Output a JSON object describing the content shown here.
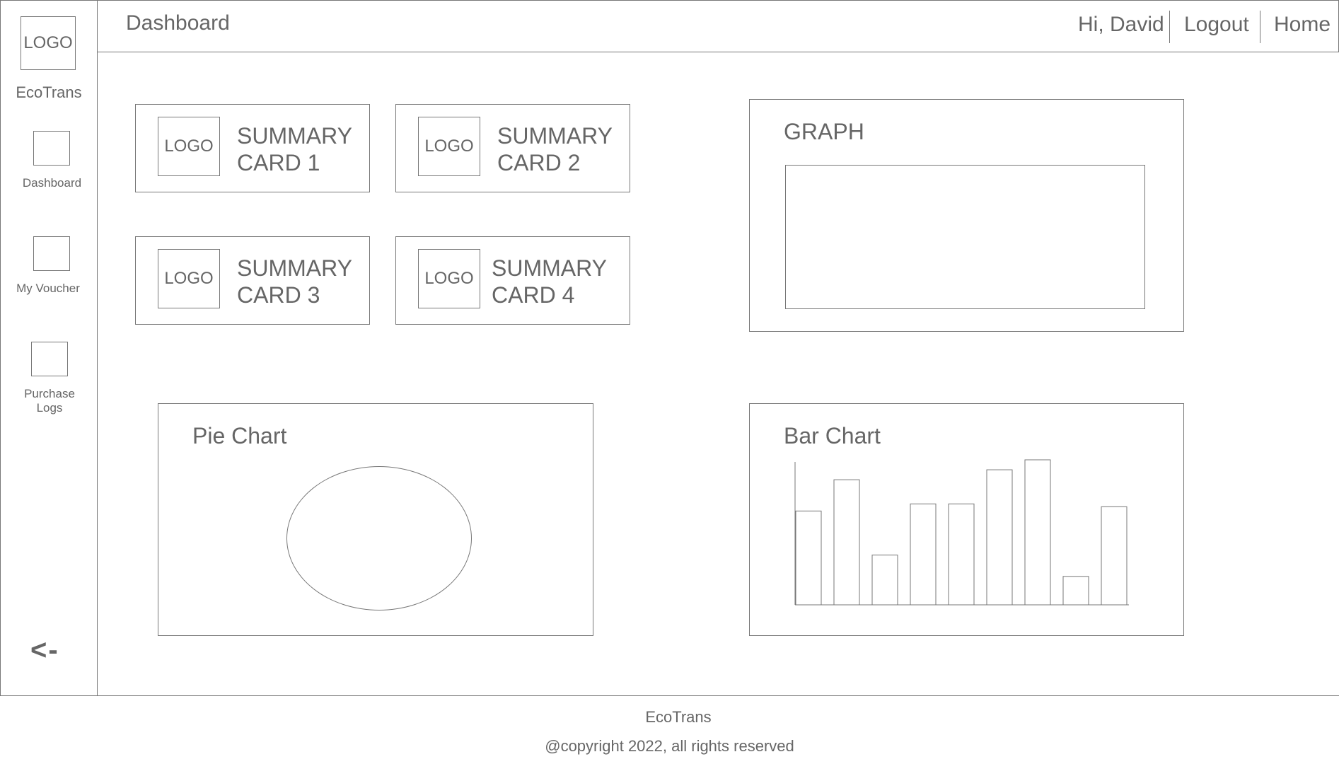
{
  "app": {
    "name": "EcoTrans",
    "logo_text": "LOGO"
  },
  "sidebar": {
    "items": [
      {
        "label": "Dashboard"
      },
      {
        "label": "My Voucher"
      },
      {
        "label": "Purchase Logs"
      }
    ],
    "collapse_label": "<-"
  },
  "header": {
    "title": "Dashboard",
    "greeting": "Hi, David",
    "logout_label": "Logout",
    "home_label": "Home"
  },
  "summary_cards": [
    {
      "logo": "LOGO",
      "line1": "SUMMARY",
      "line2": "CARD 1"
    },
    {
      "logo": "LOGO",
      "line1": "SUMMARY",
      "line2": "CARD 2"
    },
    {
      "logo": "LOGO",
      "line1": "SUMMARY",
      "line2": "CARD 3"
    },
    {
      "logo": "LOGO",
      "line1": "SUMMARY",
      "line2": "CARD 4"
    }
  ],
  "panels": {
    "graph_title": "GRAPH",
    "pie_title": "Pie Chart",
    "bar_title": "Bar Chart"
  },
  "chart_data": {
    "type": "bar",
    "title": "Bar Chart",
    "values": [
      66,
      88,
      35,
      71,
      71,
      95,
      102,
      20,
      69
    ]
  },
  "footer": {
    "brand": "EcoTrans",
    "copyright": "@copyright 2022, all rights reserved"
  },
  "colors": {
    "stroke": "#777777",
    "text": "#666666",
    "background": "#ffffff"
  }
}
